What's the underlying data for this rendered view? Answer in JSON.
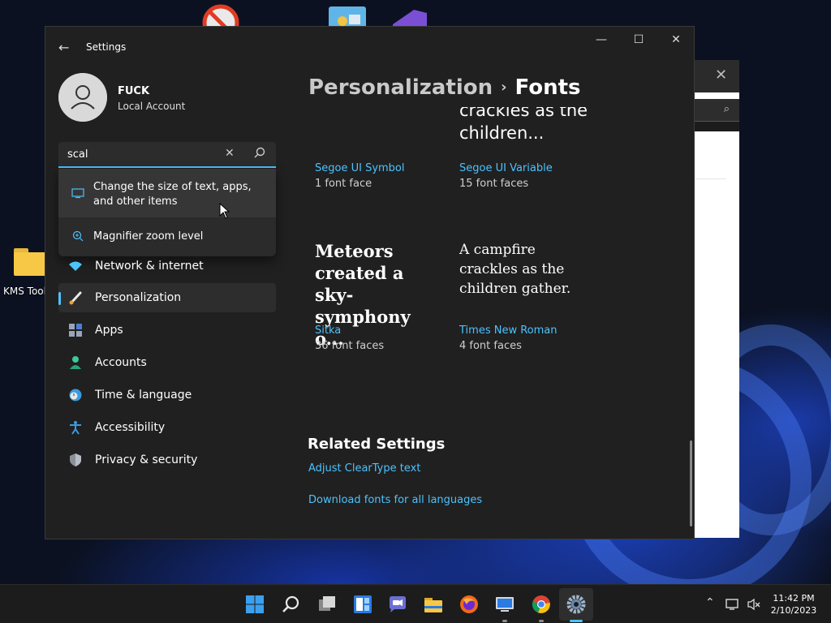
{
  "desktop": {
    "shortcut_label": "KMS Tools Portable"
  },
  "settings_window": {
    "title": "Settings",
    "user": {
      "name": "FUCK",
      "account_type": "Local Account"
    },
    "search": {
      "value": "scal",
      "suggestions": [
        {
          "label": "Change the size of text, apps, and other items",
          "icon": "display-icon"
        },
        {
          "label": "Magnifier zoom level",
          "icon": "magnifier-icon"
        }
      ]
    },
    "nav": [
      {
        "label": "Network & internet",
        "icon": "wifi-icon"
      },
      {
        "label": "Personalization",
        "icon": "brush-icon",
        "selected": true
      },
      {
        "label": "Apps",
        "icon": "apps-icon"
      },
      {
        "label": "Accounts",
        "icon": "person-icon"
      },
      {
        "label": "Time & language",
        "icon": "globe-clock-icon"
      },
      {
        "label": "Accessibility",
        "icon": "accessibility-icon"
      },
      {
        "label": "Privacy & security",
        "icon": "shield-icon"
      }
    ],
    "breadcrumb": {
      "parent": "Personalization",
      "separator": "›",
      "current": "Fonts"
    },
    "fonts": [
      {
        "preview": "crackles as the children...",
        "name": "Segoe UI Symbol",
        "faces": "1 font face",
        "partial_top": true
      },
      {
        "preview": "",
        "name": "Segoe UI Variable",
        "faces": "15 font faces"
      },
      {
        "preview": "Meteors created a sky-symphony o...",
        "name": "Sitka",
        "faces": "36 font faces"
      },
      {
        "preview": "A campfire crackles as the children gather.",
        "name": "Times New Roman",
        "faces": "4 font faces"
      }
    ],
    "related": {
      "heading": "Related Settings",
      "links": [
        "Adjust ClearType text",
        "Download fonts for all languages"
      ]
    }
  },
  "taskbar": {
    "apps": [
      "start",
      "search",
      "task-view",
      "widgets",
      "teams-chat",
      "file-explorer",
      "firefox",
      "remote-desktop",
      "chrome",
      "settings"
    ],
    "clock": {
      "time": "11:42 PM",
      "date": "2/10/2023"
    }
  },
  "colors": {
    "accent": "#4cc2ff",
    "window_bg": "#202020",
    "taskbar_bg": "#1c1c1c"
  }
}
